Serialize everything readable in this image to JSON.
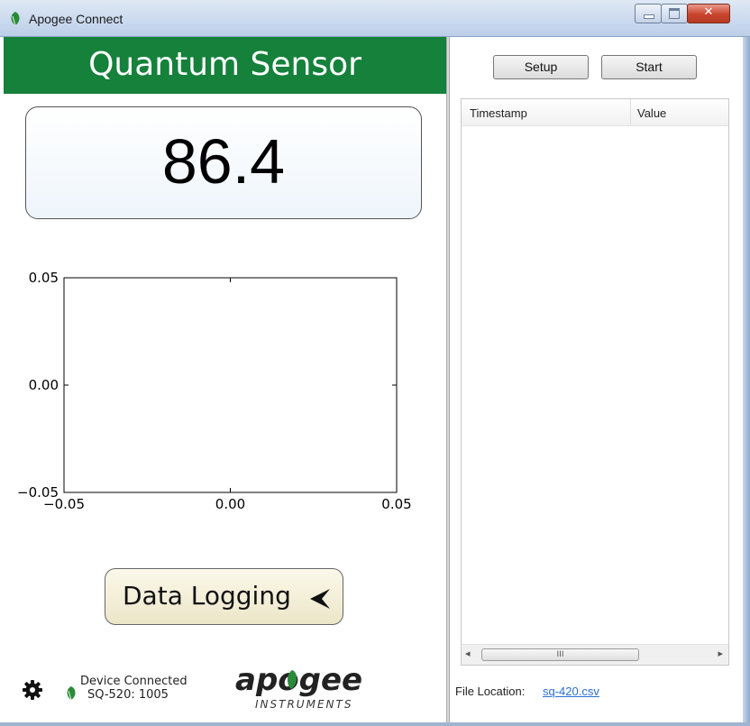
{
  "window": {
    "title": "Apogee Connect",
    "controls": {
      "minimize": "minimize",
      "maximize": "maximize",
      "close": "✕"
    }
  },
  "left": {
    "banner_title": "Quantum Sensor",
    "reading": "86.4",
    "data_logging_label": "Data Logging",
    "device_status": "Device Connected",
    "device_id": "SQ-520: 1005",
    "logo_text": "apogee",
    "logo_sub": "INSTRUMENTS"
  },
  "chart_data": {
    "type": "line",
    "series": [],
    "xlim": [
      -0.05,
      0.05
    ],
    "ylim": [
      -0.05,
      0.05
    ],
    "xticks": [
      "−0.05",
      "0.00",
      "0.05"
    ],
    "yticks": [
      "0.05",
      "0.00",
      "−0.05"
    ],
    "grid": false
  },
  "right": {
    "setup_label": "Setup",
    "start_label": "Start",
    "table": {
      "columns": [
        "Timestamp",
        "Value"
      ],
      "rows": []
    },
    "scroll_thumb_grip": "III",
    "file_location_label": "File Location:",
    "file_name": "sq-420.csv"
  },
  "colors": {
    "banner": "#15813b",
    "link": "#2a6fd0"
  }
}
